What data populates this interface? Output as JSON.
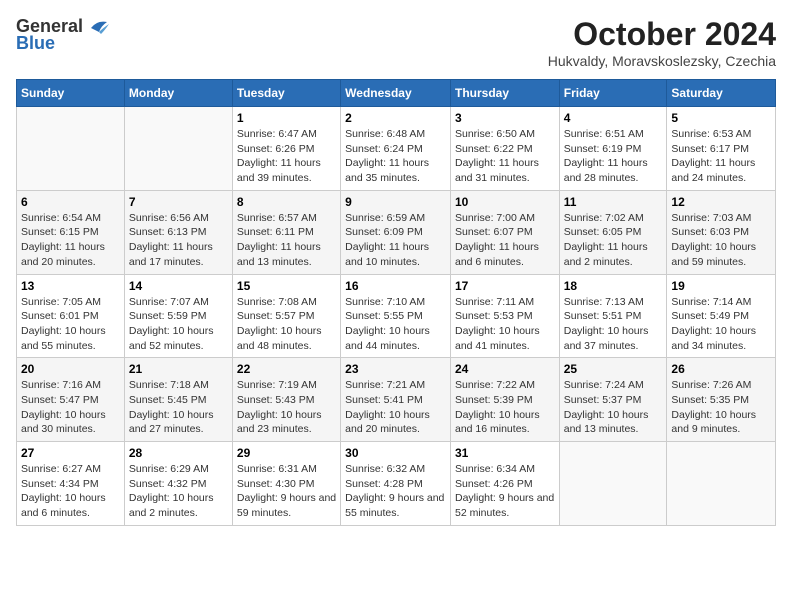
{
  "logo": {
    "general": "General",
    "blue": "Blue"
  },
  "title": "October 2024",
  "location": "Hukvaldy, Moravskoslezsky, Czechia",
  "headers": [
    "Sunday",
    "Monday",
    "Tuesday",
    "Wednesday",
    "Thursday",
    "Friday",
    "Saturday"
  ],
  "weeks": [
    [
      {
        "day": "",
        "info": ""
      },
      {
        "day": "",
        "info": ""
      },
      {
        "day": "1",
        "info": "Sunrise: 6:47 AM\nSunset: 6:26 PM\nDaylight: 11 hours and 39 minutes."
      },
      {
        "day": "2",
        "info": "Sunrise: 6:48 AM\nSunset: 6:24 PM\nDaylight: 11 hours and 35 minutes."
      },
      {
        "day": "3",
        "info": "Sunrise: 6:50 AM\nSunset: 6:22 PM\nDaylight: 11 hours and 31 minutes."
      },
      {
        "day": "4",
        "info": "Sunrise: 6:51 AM\nSunset: 6:19 PM\nDaylight: 11 hours and 28 minutes."
      },
      {
        "day": "5",
        "info": "Sunrise: 6:53 AM\nSunset: 6:17 PM\nDaylight: 11 hours and 24 minutes."
      }
    ],
    [
      {
        "day": "6",
        "info": "Sunrise: 6:54 AM\nSunset: 6:15 PM\nDaylight: 11 hours and 20 minutes."
      },
      {
        "day": "7",
        "info": "Sunrise: 6:56 AM\nSunset: 6:13 PM\nDaylight: 11 hours and 17 minutes."
      },
      {
        "day": "8",
        "info": "Sunrise: 6:57 AM\nSunset: 6:11 PM\nDaylight: 11 hours and 13 minutes."
      },
      {
        "day": "9",
        "info": "Sunrise: 6:59 AM\nSunset: 6:09 PM\nDaylight: 11 hours and 10 minutes."
      },
      {
        "day": "10",
        "info": "Sunrise: 7:00 AM\nSunset: 6:07 PM\nDaylight: 11 hours and 6 minutes."
      },
      {
        "day": "11",
        "info": "Sunrise: 7:02 AM\nSunset: 6:05 PM\nDaylight: 11 hours and 2 minutes."
      },
      {
        "day": "12",
        "info": "Sunrise: 7:03 AM\nSunset: 6:03 PM\nDaylight: 10 hours and 59 minutes."
      }
    ],
    [
      {
        "day": "13",
        "info": "Sunrise: 7:05 AM\nSunset: 6:01 PM\nDaylight: 10 hours and 55 minutes."
      },
      {
        "day": "14",
        "info": "Sunrise: 7:07 AM\nSunset: 5:59 PM\nDaylight: 10 hours and 52 minutes."
      },
      {
        "day": "15",
        "info": "Sunrise: 7:08 AM\nSunset: 5:57 PM\nDaylight: 10 hours and 48 minutes."
      },
      {
        "day": "16",
        "info": "Sunrise: 7:10 AM\nSunset: 5:55 PM\nDaylight: 10 hours and 44 minutes."
      },
      {
        "day": "17",
        "info": "Sunrise: 7:11 AM\nSunset: 5:53 PM\nDaylight: 10 hours and 41 minutes."
      },
      {
        "day": "18",
        "info": "Sunrise: 7:13 AM\nSunset: 5:51 PM\nDaylight: 10 hours and 37 minutes."
      },
      {
        "day": "19",
        "info": "Sunrise: 7:14 AM\nSunset: 5:49 PM\nDaylight: 10 hours and 34 minutes."
      }
    ],
    [
      {
        "day": "20",
        "info": "Sunrise: 7:16 AM\nSunset: 5:47 PM\nDaylight: 10 hours and 30 minutes."
      },
      {
        "day": "21",
        "info": "Sunrise: 7:18 AM\nSunset: 5:45 PM\nDaylight: 10 hours and 27 minutes."
      },
      {
        "day": "22",
        "info": "Sunrise: 7:19 AM\nSunset: 5:43 PM\nDaylight: 10 hours and 23 minutes."
      },
      {
        "day": "23",
        "info": "Sunrise: 7:21 AM\nSunset: 5:41 PM\nDaylight: 10 hours and 20 minutes."
      },
      {
        "day": "24",
        "info": "Sunrise: 7:22 AM\nSunset: 5:39 PM\nDaylight: 10 hours and 16 minutes."
      },
      {
        "day": "25",
        "info": "Sunrise: 7:24 AM\nSunset: 5:37 PM\nDaylight: 10 hours and 13 minutes."
      },
      {
        "day": "26",
        "info": "Sunrise: 7:26 AM\nSunset: 5:35 PM\nDaylight: 10 hours and 9 minutes."
      }
    ],
    [
      {
        "day": "27",
        "info": "Sunrise: 6:27 AM\nSunset: 4:34 PM\nDaylight: 10 hours and 6 minutes."
      },
      {
        "day": "28",
        "info": "Sunrise: 6:29 AM\nSunset: 4:32 PM\nDaylight: 10 hours and 2 minutes."
      },
      {
        "day": "29",
        "info": "Sunrise: 6:31 AM\nSunset: 4:30 PM\nDaylight: 9 hours and 59 minutes."
      },
      {
        "day": "30",
        "info": "Sunrise: 6:32 AM\nSunset: 4:28 PM\nDaylight: 9 hours and 55 minutes."
      },
      {
        "day": "31",
        "info": "Sunrise: 6:34 AM\nSunset: 4:26 PM\nDaylight: 9 hours and 52 minutes."
      },
      {
        "day": "",
        "info": ""
      },
      {
        "day": "",
        "info": ""
      }
    ]
  ]
}
